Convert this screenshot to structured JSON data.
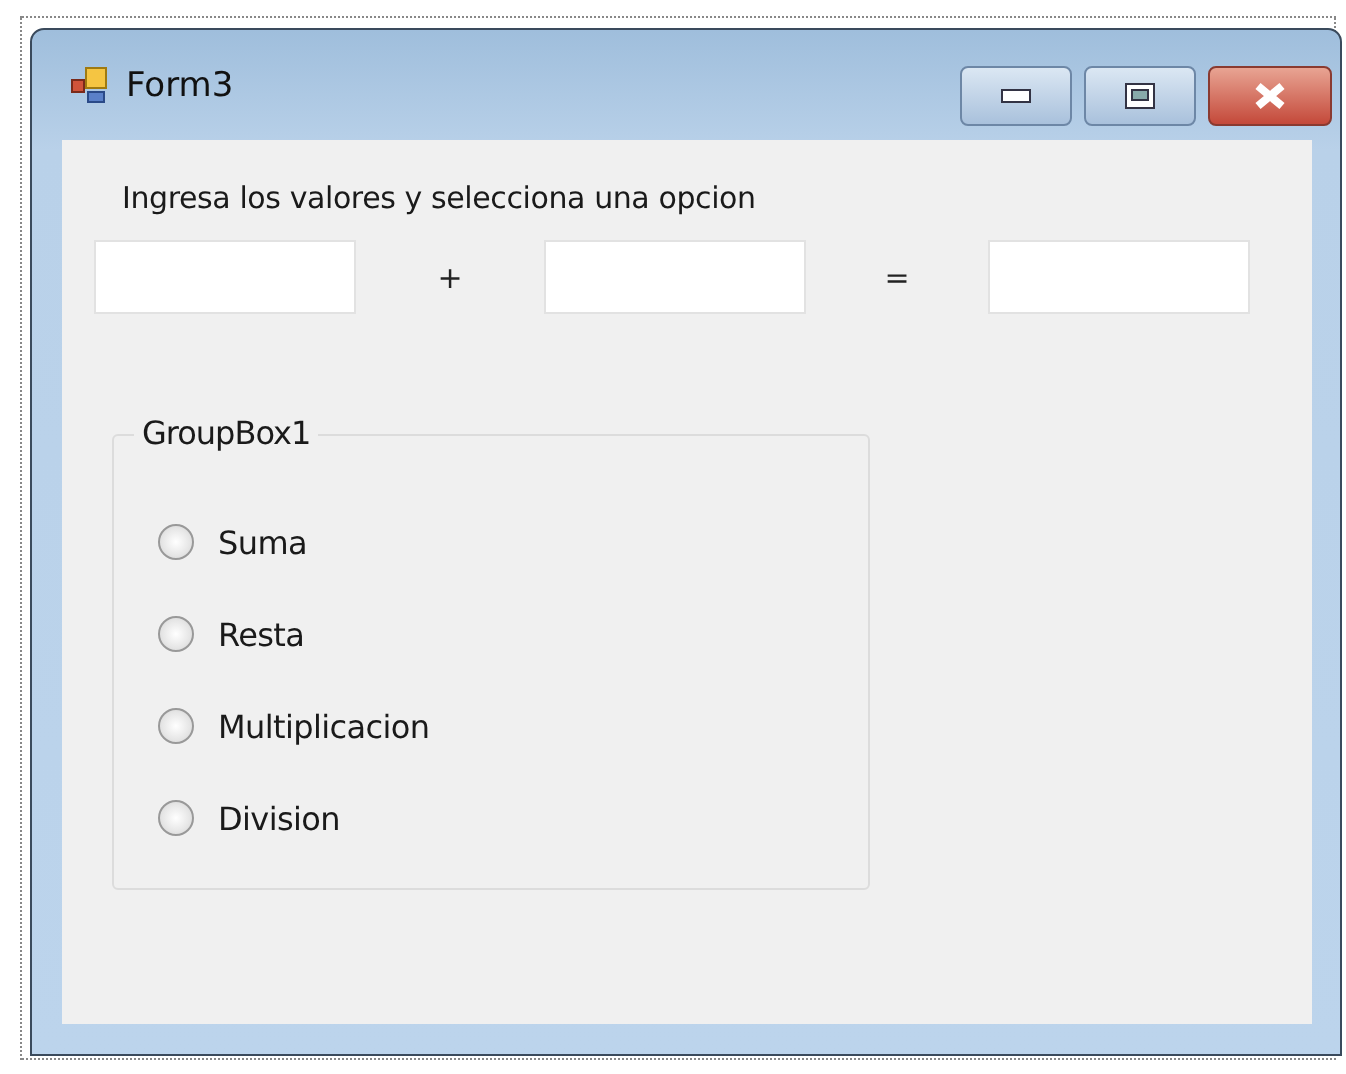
{
  "window": {
    "title": "Form3"
  },
  "instruction": "Ingresa los valores y selecciona una opcion",
  "fields": [
    {
      "kind": "textbox"
    },
    {
      "kind": "textbox"
    },
    {
      "kind": "textbox"
    }
  ],
  "operators": [
    "+",
    "="
  ],
  "group_box": {
    "title": "GroupBox1",
    "options": [
      {
        "label": "Suma",
        "selected": false
      },
      {
        "label": "Resta",
        "selected": false
      },
      {
        "label": "Multiplicacion",
        "selected": false
      },
      {
        "label": "Division",
        "selected": false
      }
    ]
  }
}
